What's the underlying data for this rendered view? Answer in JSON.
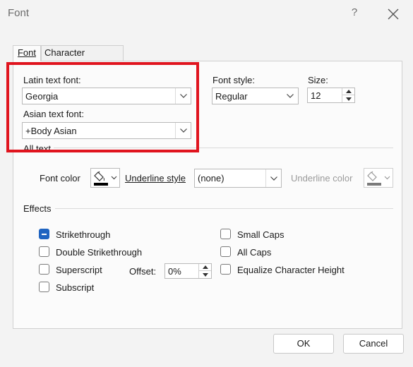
{
  "window": {
    "title": "Font",
    "help": "?"
  },
  "tabs": [
    {
      "label": "Font"
    },
    {
      "label": "Character Spacing"
    }
  ],
  "latin": {
    "label": "Latin text font:",
    "value": "Georgia"
  },
  "asian": {
    "label": "Asian text font:",
    "value": "+Body Asian"
  },
  "style": {
    "label": "Font style:",
    "value": "Regular"
  },
  "size": {
    "label": "Size:",
    "value": "12"
  },
  "all_text": {
    "header": "All text",
    "font_color_label": "Font color",
    "underline_style_label": "Underline style",
    "underline_style_value": "(none)",
    "underline_color_label": "Underline color"
  },
  "effects": {
    "header": "Effects",
    "strikethrough": "Strikethrough",
    "double_strikethrough": "Double Strikethrough",
    "superscript": "Superscript",
    "subscript": "Subscript",
    "offset_label": "Offset:",
    "offset_value": "0%",
    "small_caps": "Small Caps",
    "all_caps": "All Caps",
    "equalize": "Equalize Character Height"
  },
  "buttons": {
    "ok": "OK",
    "cancel": "Cancel"
  },
  "colors": {
    "highlight": "#e0141e",
    "checkbox_accent": "#1f64c1",
    "font_color_swatch": "#000000",
    "underline_color_swatch": "#7a7a7a"
  },
  "icons": {
    "close": "close-icon",
    "dropdown": "chevron-down-icon",
    "paint_bucket": "paint-bucket-icon"
  }
}
